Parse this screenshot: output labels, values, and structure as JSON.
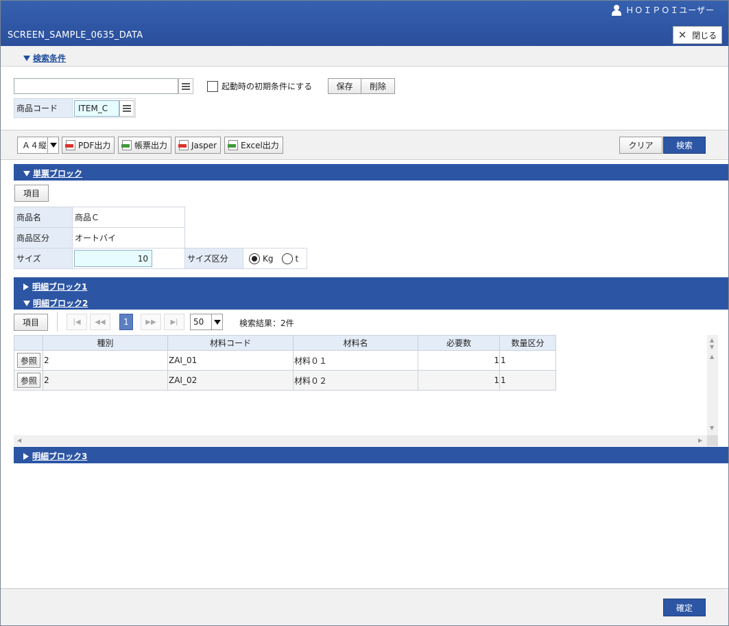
{
  "header": {
    "user_name": "ＨＯＩＰＯＩユーザー",
    "screen_title": "SCREEN_SAMPLE_0635_DATA",
    "close_label": "閉じる"
  },
  "search": {
    "section_label": "検索条件",
    "condition_value": "",
    "initial_condition_label": "起動時の初期条件にする",
    "save_label": "保存",
    "delete_label": "削除",
    "product_code_label": "商品コード",
    "product_code_value": "ITEM_C"
  },
  "toolbar": {
    "paper_size": "Ａ４縦",
    "pdf_label": "PDF出力",
    "report_label": "帳票出力",
    "jasper_label": "Jasper",
    "excel_label": "Excel出力",
    "clear_label": "クリア",
    "search_label": "検索"
  },
  "single_block": {
    "label": "単票ブロック",
    "item_button": "項目",
    "product_name_label": "商品名",
    "product_name_value": "商品Ｃ",
    "product_category_label": "商品区分",
    "product_category_value": "オートバイ",
    "size_label": "サイズ",
    "size_value": "10",
    "size_unit_label": "サイズ区分",
    "unit_options": [
      "Kg",
      "t"
    ],
    "unit_selected": "Kg"
  },
  "detail1": {
    "label": "明細ブロック1"
  },
  "detail2": {
    "label": "明細ブロック2",
    "item_button": "項目",
    "current_page": "1",
    "page_size": "50",
    "result_text": "検索結果：2件",
    "columns": [
      "種別",
      "材料コード",
      "材料名",
      "必要数",
      "数量区分"
    ],
    "ref_label": "参照",
    "rows": [
      {
        "type": "2",
        "code": "ZAI_01",
        "name": "材料０１",
        "qty": "1",
        "unit": "1"
      },
      {
        "type": "2",
        "code": "ZAI_02",
        "name": "材料０２",
        "qty": "1",
        "unit": "1"
      }
    ]
  },
  "detail3": {
    "label": "明細ブロック3"
  },
  "footer": {
    "confirm_label": "確定"
  },
  "colors": {
    "primary": "#2c55a4",
    "label_bg": "#e4ecf7",
    "input_bg": "#e6fcff"
  }
}
